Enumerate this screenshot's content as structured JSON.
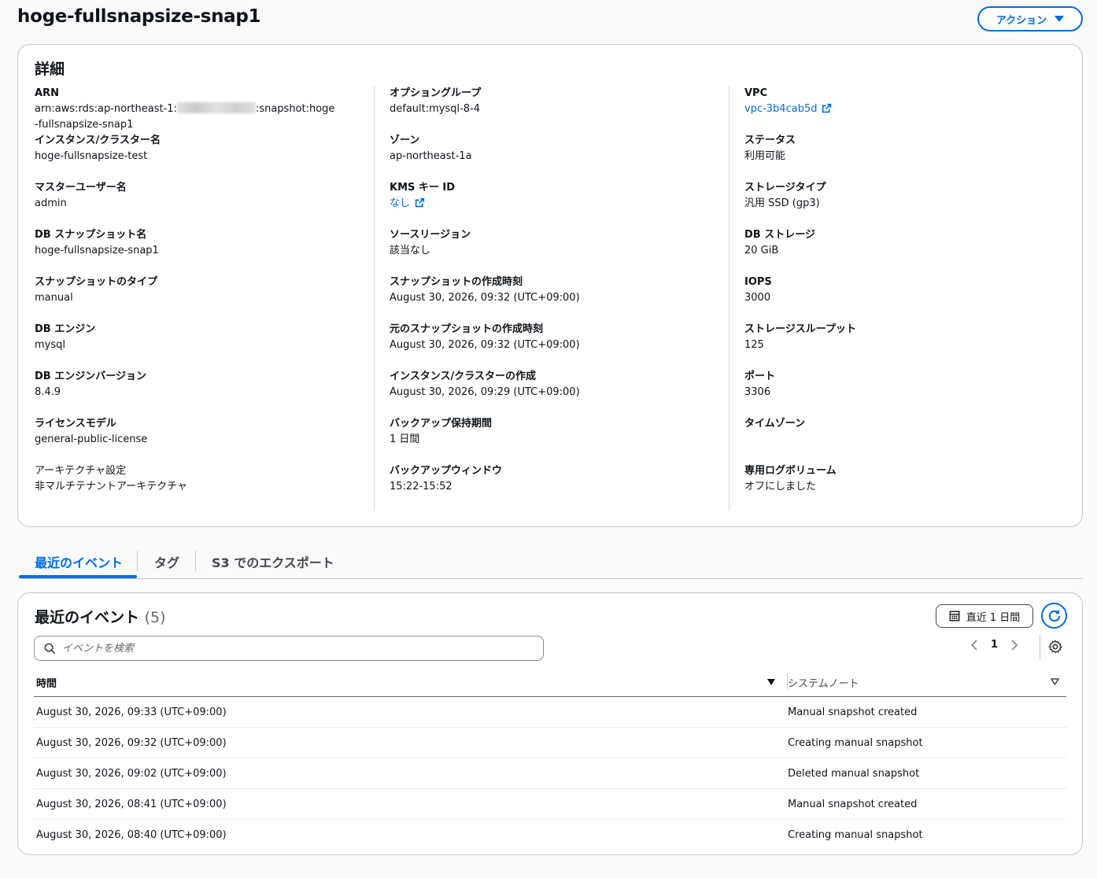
{
  "header": {
    "title": "hoge-fullsnapsize-snap1",
    "actions_label": "アクション"
  },
  "details": {
    "heading": "詳細",
    "col1": [
      {
        "key": "ARN",
        "value_prefix": "arn:aws:rds:ap-northeast-1:",
        "value_suffix": ":snapshot:hoge-fullsnapsize-snap1"
      },
      {
        "key": "インスタンス/クラスター名",
        "value": "hoge-fullsnapsize-test"
      },
      {
        "key": "マスターユーザー名",
        "value": "admin"
      },
      {
        "key": "DB スナップショット名",
        "value": "hoge-fullsnapsize-snap1"
      },
      {
        "key": "スナップショットのタイプ",
        "value": "manual"
      },
      {
        "key": "DB エンジン",
        "value": "mysql"
      },
      {
        "key": "DB エンジンバージョン",
        "value": "8.4.9"
      },
      {
        "key": "ライセンスモデル",
        "value": "general-public-license"
      },
      {
        "key": "アーキテクチャ設定",
        "value": "非マルチテナントアーキテクチャ"
      }
    ],
    "col2": [
      {
        "key": "オプショングループ",
        "value": "default:mysql-8-4"
      },
      {
        "key": "ゾーン",
        "value": "ap-northeast-1a"
      },
      {
        "key": "KMS キー ID",
        "value": "なし"
      },
      {
        "key": "ソースリージョン",
        "value": "該当なし"
      },
      {
        "key": "スナップショットの作成時刻",
        "value": "August 30, 2026, 09:32 (UTC+09:00)"
      },
      {
        "key": "元のスナップショットの作成時刻",
        "value": "August 30, 2026, 09:32 (UTC+09:00)"
      },
      {
        "key": "インスタンス/クラスターの作成",
        "value": "August 30, 2026, 09:29 (UTC+09:00)"
      },
      {
        "key": "バックアップ保持期間",
        "value": "1 日間"
      },
      {
        "key": "バックアップウィンドウ",
        "value": "15:22-15:52"
      }
    ],
    "col3": [
      {
        "key": "VPC",
        "value": "vpc-3b4cab5d"
      },
      {
        "key": "ステータス",
        "value": "利用可能"
      },
      {
        "key": "ストレージタイプ",
        "value": "汎用 SSD (gp3)"
      },
      {
        "key": "DB ストレージ",
        "value": "20 GiB"
      },
      {
        "key": "IOPS",
        "value": "3000"
      },
      {
        "key": "ストレージスループット",
        "value": "125"
      },
      {
        "key": "ポート",
        "value": "3306"
      },
      {
        "key": "タイムゾーン",
        "value": ""
      },
      {
        "key": "専用ログボリューム",
        "value": "オフにしました"
      }
    ]
  },
  "tabs": [
    "最近のイベント",
    "タグ",
    "S3 でのエクスポート"
  ],
  "events": {
    "title": "最近のイベント",
    "count": "(5)",
    "range_label": "直近 1 日間",
    "search_placeholder": "イベントを検索",
    "page": "1",
    "columns": [
      "時間",
      "システムノート"
    ],
    "rows": [
      {
        "time": "August 30, 2026, 09:33 (UTC+09:00)",
        "note": "Manual snapshot created"
      },
      {
        "time": "August 30, 2026, 09:32 (UTC+09:00)",
        "note": "Creating manual snapshot"
      },
      {
        "time": "August 30, 2026, 09:02 (UTC+09:00)",
        "note": "Deleted manual snapshot"
      },
      {
        "time": "August 30, 2026, 08:41 (UTC+09:00)",
        "note": "Manual snapshot created"
      },
      {
        "time": "August 30, 2026, 08:40 (UTC+09:00)",
        "note": "Creating manual snapshot"
      }
    ]
  },
  "colors": {
    "accent": "#006ce0",
    "border": "#c6c6cd",
    "text": "#0f141a"
  }
}
